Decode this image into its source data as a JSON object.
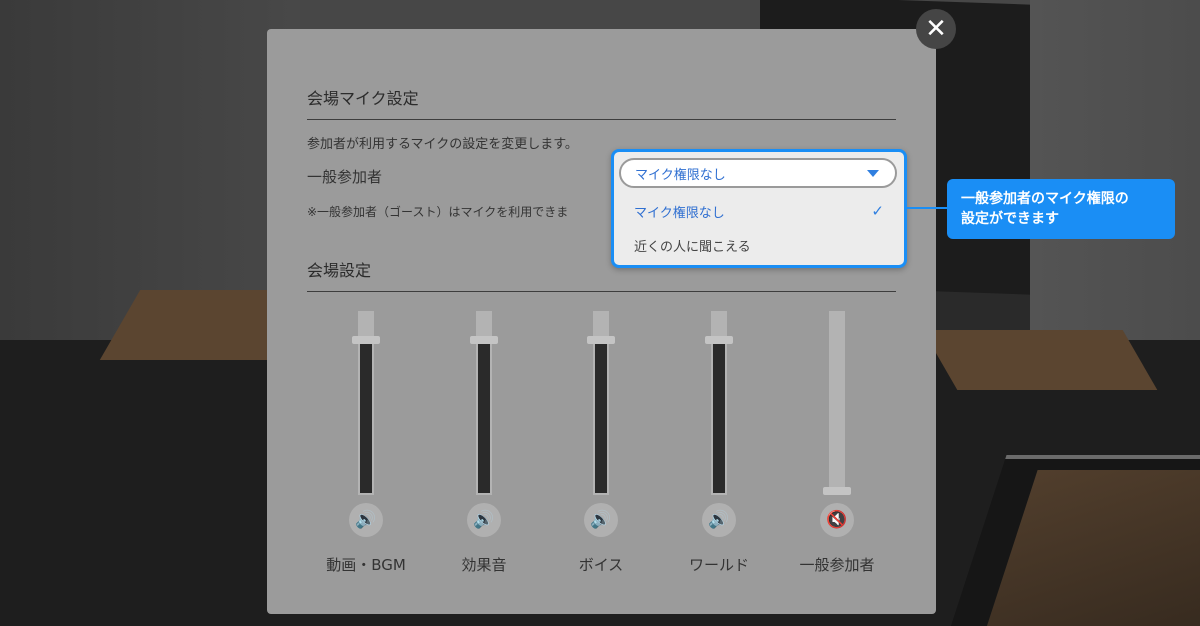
{
  "close_label": "✕",
  "mic_section": {
    "title": "会場マイク設定",
    "description": "参加者が利用するマイクの設定を変更します。",
    "row_label": "一般参加者",
    "note": "※一般参加者（ゴースト）はマイクを利用できま",
    "dropdown": {
      "selected_value": "マイク権限なし",
      "options": [
        {
          "label": "マイク権限なし",
          "selected": true
        },
        {
          "label": "近くの人に聞こえる",
          "selected": false
        }
      ]
    }
  },
  "tooltip": {
    "line1": "一般参加者のマイク権限の",
    "line2": "設定ができます"
  },
  "venue_section": {
    "title": "会場設定",
    "channels": [
      {
        "label": "動画・BGM",
        "level": 0.83,
        "icon": "speaker-icon",
        "glyph": "🔊"
      },
      {
        "label": "効果音",
        "level": 0.83,
        "icon": "speaker-icon",
        "glyph": "🔊"
      },
      {
        "label": "ボイス",
        "level": 0.83,
        "icon": "speaker-icon",
        "glyph": "🔊"
      },
      {
        "label": "ワールド",
        "level": 0.83,
        "icon": "speaker-icon",
        "glyph": "🔊"
      },
      {
        "label": "一般参加者",
        "level": 0.0,
        "icon": "speaker-muted-icon",
        "glyph": "🔇"
      }
    ]
  },
  "colors": {
    "accent": "#1a8ef5",
    "modal_bg": "#9b9b9b"
  }
}
